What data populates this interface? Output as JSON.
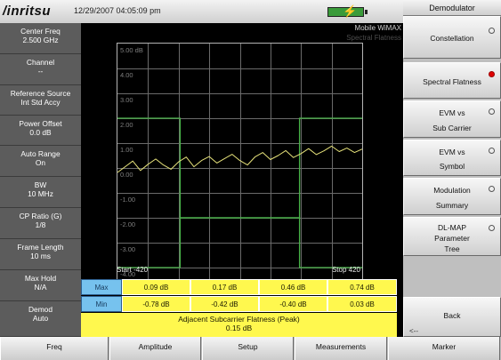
{
  "header": {
    "logo": "/inritsu",
    "datetime": "12/29/2007 04:05:09 pm"
  },
  "left_panel": {
    "items": [
      {
        "label": "Center Freq",
        "value": "2.500 GHz"
      },
      {
        "label": "Channel",
        "value": "--"
      },
      {
        "label": "Reference Source",
        "value": "Int Std Accy"
      },
      {
        "label": "Power Offset",
        "value": "0.0 dB"
      },
      {
        "label": "Auto Range",
        "value": "On"
      },
      {
        "label": "BW",
        "value": "10 MHz"
      },
      {
        "label": "CP Ratio (G)",
        "value": "1/8"
      },
      {
        "label": "Frame Length",
        "value": "10 ms"
      },
      {
        "label": "Max Hold",
        "value": "N/A"
      },
      {
        "label": "Demod",
        "value": "Auto"
      }
    ]
  },
  "screen": {
    "mode": "Mobile WiMAX",
    "view": "Spectral Flatness",
    "start_label": "Start -420",
    "stop_label": "Stop 420"
  },
  "chart_data": {
    "type": "line",
    "title": "",
    "x_range": [
      -420,
      420
    ],
    "ylim": [
      -4.5,
      5.0
    ],
    "y_ticks": [
      "5.00 dB",
      "4.00",
      "3.00",
      "2.00",
      "1.00",
      "0.00",
      "-1.00",
      "-2.00",
      "-3.00",
      "-4.00"
    ],
    "grid": true,
    "series": [
      {
        "values": [
          -0.18,
          0.05,
          0.28,
          -0.1,
          0.15,
          0.36,
          0.12,
          -0.05,
          0.25,
          0.44,
          0.05,
          0.3,
          0.46,
          0.2,
          0.38,
          0.55,
          0.3,
          0.12,
          0.45,
          0.62,
          0.34,
          0.5,
          0.7,
          0.42,
          0.58,
          0.78,
          0.54,
          0.69,
          0.88,
          0.66,
          0.8,
          0.62,
          0.76
        ]
      },
      {
        "values": [
          2.0,
          2.0,
          -2.0,
          -2.0,
          2.0,
          2.0
        ],
        "x": [
          -420,
          -205,
          -205,
          205,
          205,
          420
        ]
      },
      {
        "values": [
          -4.0,
          -4.0,
          -2.0,
          -2.0,
          -4.0,
          -4.0
        ],
        "x": [
          -420,
          -205,
          -205,
          205,
          205,
          420
        ]
      }
    ]
  },
  "results": {
    "max_label": "Max",
    "min_label": "Min",
    "max_values": [
      "0.09 dB",
      "0.17 dB",
      "0.46 dB",
      "0.74 dB"
    ],
    "min_values": [
      "-0.78 dB",
      "-0.42 dB",
      "-0.40 dB",
      "0.03 dB"
    ],
    "footer_title": "Adjacent Subcarrier Flatness (Peak)",
    "footer_value": "0.15 dB"
  },
  "right_panel": {
    "title": "Demodulator",
    "buttons": [
      {
        "line1": "Constellation",
        "line2": "",
        "selected": false
      },
      {
        "line1": "Spectral Flatness",
        "line2": "",
        "selected": true
      },
      {
        "line1": "EVM vs",
        "line2": "Sub Carrier",
        "selected": false
      },
      {
        "line1": "EVM vs",
        "line2": "Symbol",
        "selected": false
      },
      {
        "line1": "Modulation",
        "line2": "Summary",
        "selected": false
      },
      {
        "line1": "DL-MAP",
        "line2": "Parameter",
        "line3": "Tree",
        "selected": false
      }
    ],
    "back_label": "Back",
    "back_arrow": "<--"
  },
  "bottom_menu": [
    "Freq",
    "Amplitude",
    "Setup",
    "Measurements",
    "Marker"
  ],
  "colors": {
    "trace": "#e6e27a",
    "limit": "#49b449",
    "table_label_bg": "#76c2ee",
    "table_cell_bg": "#fff84e",
    "selected_dot": "#e00000"
  }
}
